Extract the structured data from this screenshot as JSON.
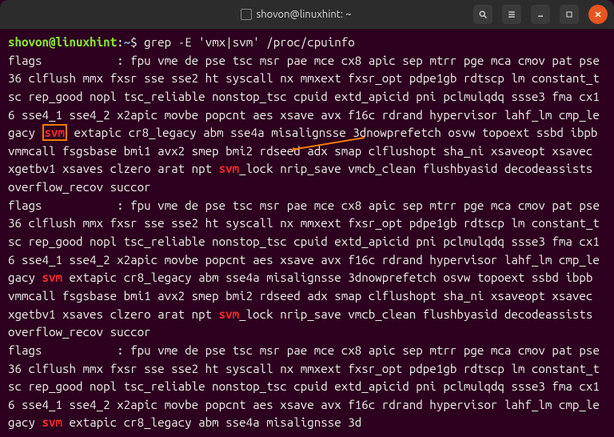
{
  "titlebar": {
    "title": "shovon@linuxhint: ~"
  },
  "prompt": {
    "user_host": "shovon@linuxhint",
    "colon": ":",
    "path": "~",
    "dollar": "$"
  },
  "command": " grep -E 'vmx|svm' /proc/cpuinfo",
  "match_text": "svm",
  "flags": {
    "label": "flags           :",
    "seg1": " fpu vme de pse tsc msr pae mce cx8 apic sep mtrr pge mca cmov pat pse36 clflush mmx fxsr sse sse2 ht syscall nx mmxext fxsr_opt pdpe1gb rdtscp lm constant_tsc rep_good nopl tsc_reliable nonstop_tsc cpuid extd_apicid pni pclmulqdq ssse3 fma cx16 sse4_1 sse4_2 x2apic movbe popcnt aes xsave avx f16c rdrand hypervisor lahf_lm cmp_legacy ",
    "seg2": " extapic cr8_legacy abm sse4a misalignsse 3dnowprefetch osvw topoext ssbd ibpb vmmcall fsgsbase bmi1 avx2 smep bmi2 rdseed adx smap clflushopt sha_ni xsaveopt xsavec xgetbv1 xsaves clzero arat npt ",
    "seg3": "_lock nrip_save vmcb_clean flushbyasid decodeassists overflow_recov succor",
    "seg2_first": " extapic cr8_legacy abm sse4a misalignsse 3dnowprefetch osvw topoext ssbd ibpb vmmcall fsgsbase bmi1 avx2 smep bmi2 rdseed adx smap clflushopt sha_ni xsaveopt xsavec xgetbv1 xsaves clzero arat npt ",
    "seg_short": " extapic cr8_legacy abm sse4a misalignsse 3d"
  },
  "colors": {
    "bg": "#2c001e",
    "prompt_user": "#8ae234",
    "prompt_path": "#729fcf",
    "match": "#ef2929",
    "annotation": "#f57900"
  }
}
